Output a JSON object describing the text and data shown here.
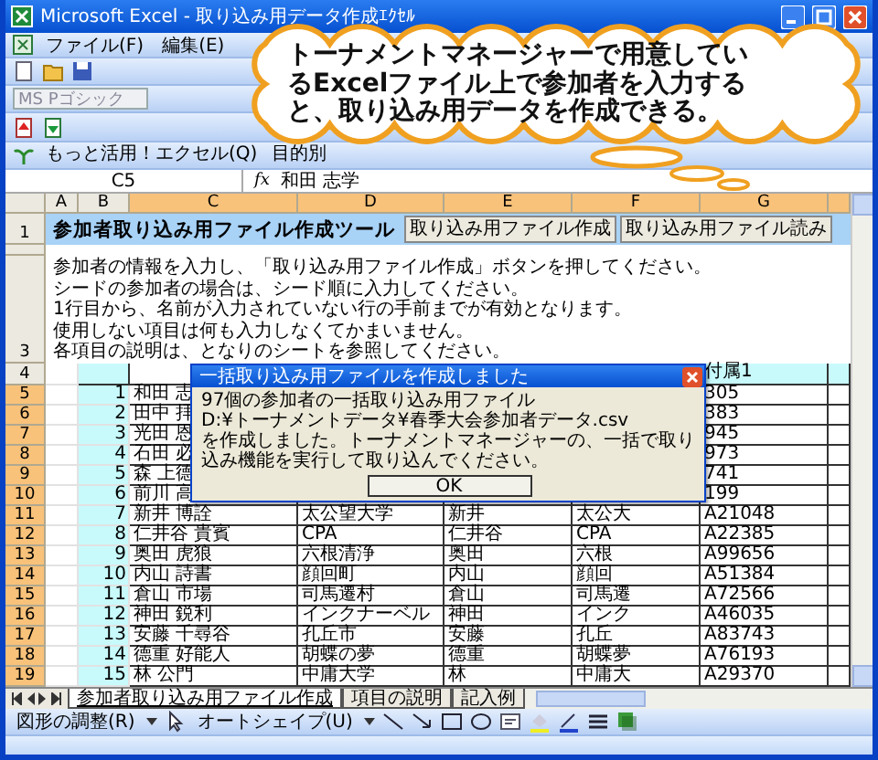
{
  "window": {
    "title": "Microsoft Excel - 取り込み用データ作成ｴｸｾﾙ"
  },
  "menu": [
    {
      "label": "ファイル(F)"
    },
    {
      "label": "編集(E)"
    }
  ],
  "font_box": {
    "value": "MS Pゴシック"
  },
  "link_toolbar": [
    {
      "label": "もっと活用！エクセル(Q)"
    },
    {
      "label": "目的別"
    }
  ],
  "formula_bar": {
    "cell": "C5",
    "fx": "fx",
    "value": "和田 志学"
  },
  "columns": [
    {
      "label": "A",
      "selected": false
    },
    {
      "label": "B",
      "selected": false
    },
    {
      "label": "C",
      "selected": true
    },
    {
      "label": "D",
      "selected": true
    },
    {
      "label": "E",
      "selected": true
    },
    {
      "label": "F",
      "selected": true
    },
    {
      "label": "G",
      "selected": true
    }
  ],
  "row_headers": [
    {
      "label": "1",
      "selected": false
    },
    {
      "label": "3",
      "selected": false
    },
    {
      "label": "4",
      "selected": false
    },
    {
      "label": "5",
      "selected": true
    },
    {
      "label": "6",
      "selected": true
    },
    {
      "label": "7",
      "selected": true
    },
    {
      "label": "8",
      "selected": true
    },
    {
      "label": "9",
      "selected": true
    },
    {
      "label": "10",
      "selected": true
    },
    {
      "label": "11",
      "selected": true
    },
    {
      "label": "12",
      "selected": true
    },
    {
      "label": "13",
      "selected": true
    },
    {
      "label": "14",
      "selected": true
    },
    {
      "label": "15",
      "selected": true
    },
    {
      "label": "16",
      "selected": true
    },
    {
      "label": "17",
      "selected": true
    },
    {
      "label": "18",
      "selected": true
    },
    {
      "label": "19",
      "selected": true
    }
  ],
  "sheet_title": "参加者取り込み用ファイル作成ツール",
  "sheet_buttons": [
    {
      "label": "取り込み用ファイル作成"
    },
    {
      "label": "取り込み用ファイル読み"
    }
  ],
  "instructions": [
    "参加者の情報を入力し、「取り込み用ファイル作成」ボタンを押してください。",
    "シードの参加者の場合は、シード順に入力してください。",
    "1行目から、名前が入力されていない行の手前までが有効となります。",
    "使用しない項目は何も入力しなくてかまいません。",
    "各項目の説明は、となりのシートを参照してください。"
  ],
  "header_g": "付属1",
  "rows": [
    {
      "no": "1",
      "name": "和田 志",
      "col_g": "305"
    },
    {
      "no": "2",
      "name": "田中 拝",
      "col_g": "383"
    },
    {
      "no": "3",
      "name": "光田 恩",
      "col_g": "945"
    },
    {
      "no": "4",
      "name": "石田 必",
      "col_g": "973"
    },
    {
      "no": "5",
      "name": "森 上德",
      "col_g": "741"
    },
    {
      "no": "6",
      "name": "前川 高",
      "col_g": "199"
    },
    {
      "no": "7",
      "name": "新井 博詮",
      "col_d": "太公望大学",
      "col_e": "新井",
      "col_f": "太公大",
      "col_g": "A21048"
    },
    {
      "no": "8",
      "name": "仁井谷 貴賓",
      "col_d": "CPA",
      "col_e": "仁井谷",
      "col_f": "CPA",
      "col_g": "A22385"
    },
    {
      "no": "9",
      "name": "奥田 虎狼",
      "col_d": "六根清浄",
      "col_e": "奥田",
      "col_f": "六根",
      "col_g": "A99656"
    },
    {
      "no": "10",
      "name": "内山 詩書",
      "col_d": "顔回町",
      "col_e": "内山",
      "col_f": "顔回",
      "col_g": "A51384"
    },
    {
      "no": "11",
      "name": "倉山 市場",
      "col_d": "司馬遷村",
      "col_e": "倉山",
      "col_f": "司馬遷",
      "col_g": "A72566"
    },
    {
      "no": "12",
      "name": "神田 鋭利",
      "col_d": "インクナーベル",
      "col_e": "神田",
      "col_f": "インク",
      "col_g": "A46035"
    },
    {
      "no": "13",
      "name": "安藤 千尋谷",
      "col_d": "孔丘市",
      "col_e": "安藤",
      "col_f": "孔丘",
      "col_g": "A83743"
    },
    {
      "no": "14",
      "name": "德重 好能人",
      "col_d": "胡蝶の夢",
      "col_e": "德重",
      "col_f": "胡蝶夢",
      "col_g": "A76193"
    },
    {
      "no": "15",
      "name": "林 公門",
      "col_d": "中庸大学",
      "col_e": "林",
      "col_f": "中庸大",
      "col_g": "A29370"
    }
  ],
  "sheet_tabs": [
    {
      "label": "参加者取り込み用ファイル作成",
      "selected": true
    },
    {
      "label": "項目の説明",
      "selected": false
    },
    {
      "label": "記入例",
      "selected": false
    }
  ],
  "drawing_toolbar": [
    {
      "label": "図形の調整(R)"
    },
    {
      "label": "オートシェイプ(U)"
    }
  ],
  "dialog": {
    "title": "一括取り込み用ファイルを作成しました",
    "lines": [
      "97個の参加者の一括取り込み用ファイル",
      "D:¥トーナメントデータ¥春季大会参加者データ.csv",
      "を作成しました。トーナメントマネージャーの、一括で取り込み機能を実行して取り込んでください。"
    ],
    "button": "OK"
  },
  "callout": {
    "lines": [
      "トーナメントマネージャーで用意してい",
      "るExcelファイル上で参加者を入力する",
      "と、取り込み用データを作成できる。"
    ]
  }
}
